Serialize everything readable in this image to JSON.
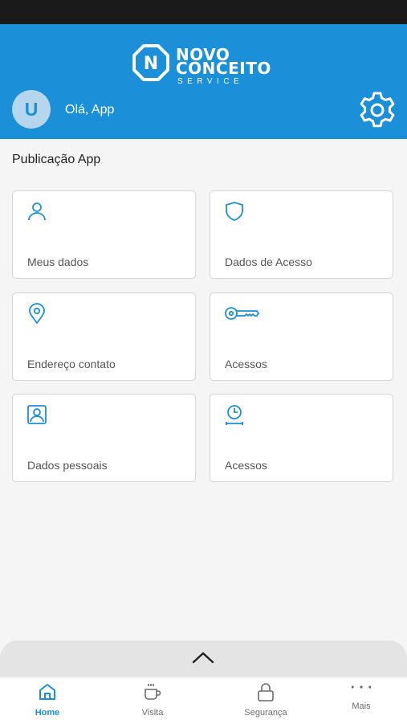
{
  "header": {
    "logo": {
      "line1": "NOVO",
      "line2": "CONCEITO",
      "line3": "SERVICE",
      "badge_letter": "N"
    },
    "avatar_initial": "U",
    "greeting": "Olá, App",
    "settings_icon": "gear-icon"
  },
  "section_title": "Publicação App",
  "cards": [
    {
      "label": "Meus dados",
      "icon": "user-icon"
    },
    {
      "label": "Dados de Acesso",
      "icon": "shield-icon"
    },
    {
      "label": "Endereço contato",
      "icon": "location-pin-icon"
    },
    {
      "label": "Acessos",
      "icon": "key-icon"
    },
    {
      "label": "Dados pessoais",
      "icon": "profile-card-icon"
    },
    {
      "label": "Acessos",
      "icon": "clock-icon"
    }
  ],
  "drawer": {
    "icon": "chevron-up-icon"
  },
  "bottom_nav": [
    {
      "label": "Home",
      "icon": "home-icon",
      "active": true
    },
    {
      "label": "Visita",
      "icon": "coffee-cup-icon",
      "active": false
    },
    {
      "label": "Segurança",
      "icon": "lock-icon",
      "active": false
    },
    {
      "label": "Mais",
      "icon": "more-dots-icon",
      "active": false
    }
  ],
  "colors": {
    "primary": "#1b8fd8",
    "status_bar": "#1a1a1a",
    "background": "#f5f5f5",
    "card_border": "#d4d4d4",
    "nav_inactive": "#6b6b6b"
  }
}
